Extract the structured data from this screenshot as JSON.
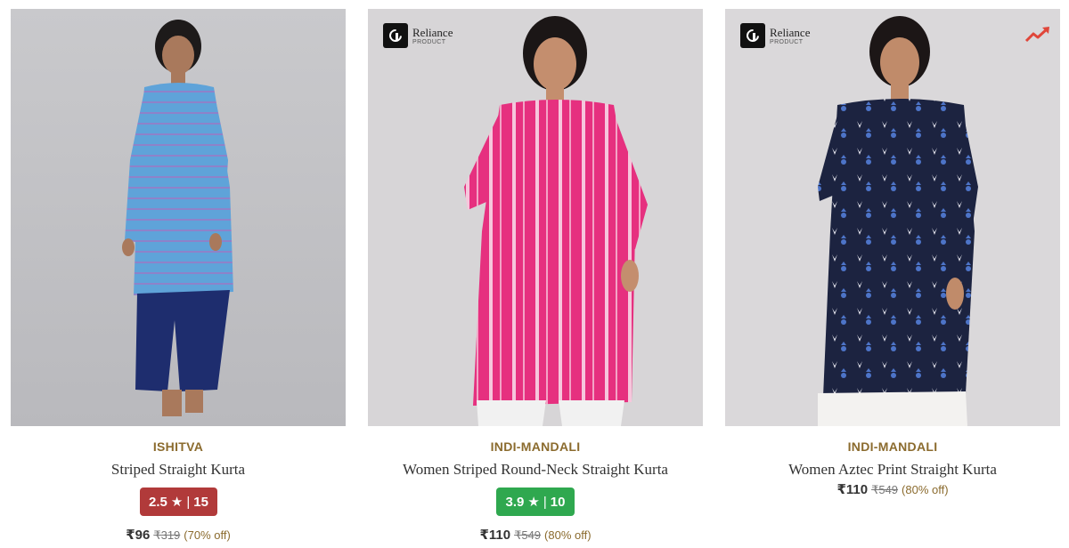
{
  "products": [
    {
      "brand": "ISHITVA",
      "title": "Striped Straight Kurta",
      "rating": {
        "score": "2.5",
        "star": "★",
        "separator": "|",
        "count": "15",
        "color": "#b13a3a"
      },
      "price": "₹96",
      "mrp": "₹319",
      "discount": "(70% off)",
      "reliance_product": false,
      "trending": false
    },
    {
      "brand": "INDI-MANDALI",
      "title": "Women Striped Round-Neck Straight Kurta",
      "rating": {
        "score": "3.9",
        "star": "★",
        "separator": "|",
        "count": "10",
        "color": "#2fa84f"
      },
      "price": "₹110",
      "mrp": "₹549",
      "discount": "(80% off)",
      "reliance_product": true,
      "trending": false
    },
    {
      "brand": "INDI-MANDALI",
      "title": "Women Aztec Print Straight Kurta",
      "rating": null,
      "price": "₹110",
      "mrp": "₹549",
      "discount": "(80% off)",
      "reliance_product": true,
      "trending": true
    }
  ],
  "badge": {
    "name": "Reliance",
    "sub": "PRODUCT"
  },
  "colors": {
    "brand_text": "#8b6b2e",
    "trending_icon": "#e0463a"
  }
}
